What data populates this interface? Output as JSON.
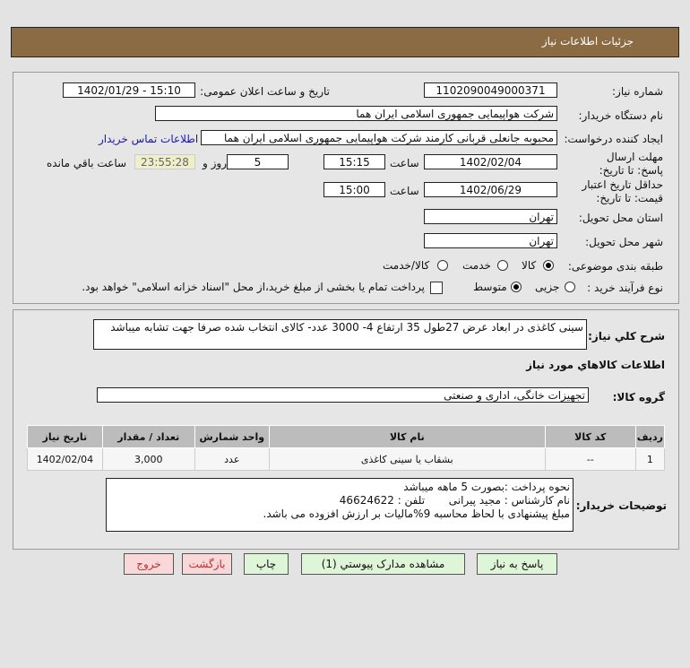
{
  "header": {
    "title": "جزئیات اطلاعات نیاز"
  },
  "form": {
    "need_number_label": "شماره نیاز:",
    "need_number": "1102090049000371",
    "announce_label": "تاریخ و ساعت اعلان عمومی:",
    "announce_value": "1402/01/29 - 15:10",
    "buyer_label": "نام دستگاه خریدار:",
    "buyer": "شرکت هواپیمایی جمهوری اسلامی ایران هما",
    "creator_label": "ایجاد کننده درخواست:",
    "creator": "محبوبه جانعلی قربانی کارمند شرکت هواپیمایی جمهوری اسلامی ایران هما",
    "contact_link": "اطلاعات تماس خریدار",
    "deadline_label": "مهلت ارسال پاسخ: تا تاریخ:",
    "deadline_date": "1402/02/04",
    "time_label": "ساعت",
    "deadline_time": "15:15",
    "days": "5",
    "days_label": "روز و",
    "remaining": "23:55:28",
    "remaining_label": "ساعت باقي مانده",
    "validity_label": "حداقل تاریخ اعتبار قیمت: تا تاریخ:",
    "validity_date": "1402/06/29",
    "validity_time": "15:00",
    "province_label": "استان محل تحویل:",
    "province": "تهران",
    "city_label": "شهر محل تحویل:",
    "city": "تهران",
    "category_label": "طبقه بندی موضوعی:",
    "category_options": [
      "کالا",
      "خدمت",
      "کالا/خدمت"
    ],
    "category_selected": "کالا",
    "process_label": "نوع فرآیند خرید :",
    "process_options": [
      "جزیی",
      "متوسط"
    ],
    "process_selected": "متوسط",
    "payment_note": "پرداخت تمام یا بخشی از مبلغ خرید،از محل \"اسناد خزانه اسلامی\" خواهد بود."
  },
  "details": {
    "summary_label": "شرح کلي نياز:",
    "summary": "سینی کاغذی در ابعاد عرض 27طول 35 ارتفاع 4- 3000 عدد- کالای انتخاب شده صرفا جهت تشابه میباشد",
    "goods_title": "اطلاعات کالاهاي مورد نياز",
    "group_label": "گروه کالا:",
    "group": "تجهیزات خانگی، اداری و صنعتی",
    "table": {
      "headers": [
        "ردیف",
        "کد کالا",
        "نام کالا",
        "واحد شمارش",
        "تعداد / مقدار",
        "تاریخ نیاز"
      ],
      "rows": [
        [
          "1",
          "--",
          "بشقاب یا سینی کاغذی",
          "عدد",
          "3,000",
          "1402/02/04"
        ]
      ]
    },
    "notes_label": "توضیحات خریدار:",
    "notes": [
      "نحوه پرداخت :بصورت 5 ماهه میباشد",
      "نام کارشناس : مجید پیرانی       تلفن : 46624622",
      "مبلغ پیشنهادی با لحاظ محاسبه 9%مالیات بر ارزش افزوده می باشد."
    ]
  },
  "buttons": {
    "reply": "پاسخ به نیاز",
    "attachments": "مشاهده مدارک پیوستي (1)",
    "print": "چاپ",
    "back": "بازگشت",
    "exit": "خروج"
  }
}
